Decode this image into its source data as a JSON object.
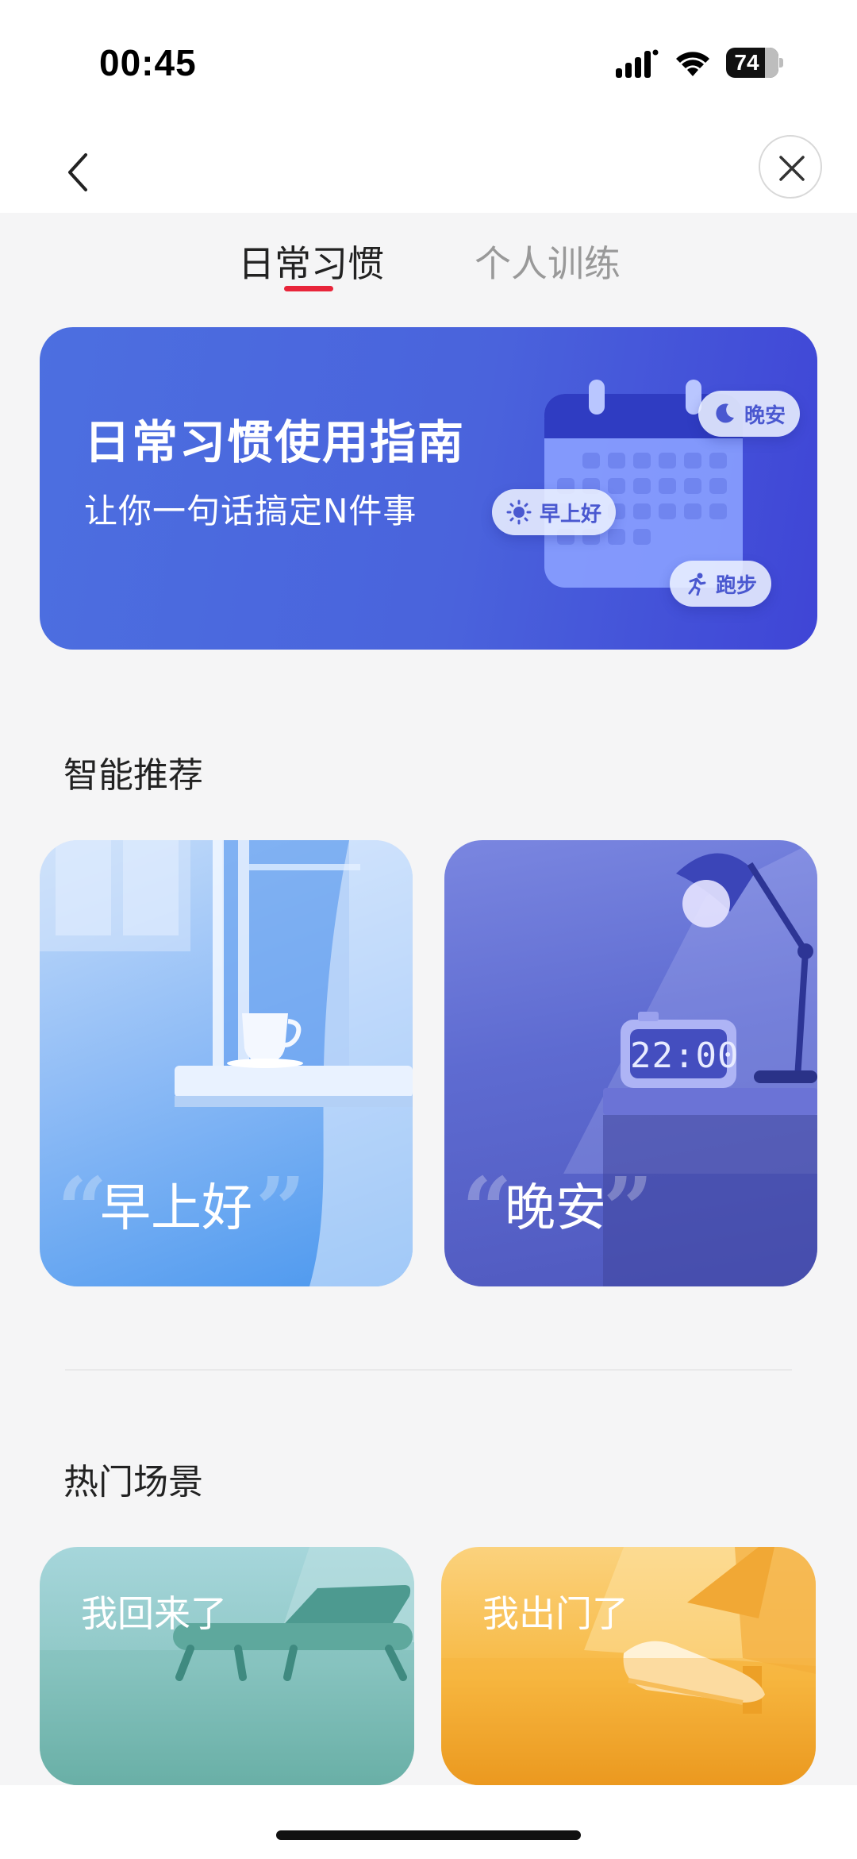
{
  "status_bar": {
    "time": "00:45",
    "battery": "74"
  },
  "tabs": [
    {
      "label": "日常习惯",
      "active": true
    },
    {
      "label": "个人训练",
      "active": false
    }
  ],
  "banner": {
    "title": "日常习惯使用指南",
    "subtitle": "让你一句话搞定N件事",
    "chips": {
      "night": "晚安",
      "morning": "早上好",
      "run": "跑步"
    }
  },
  "recommend": {
    "title": "智能推荐",
    "cards": [
      {
        "label": "早上好"
      },
      {
        "label": "晚安",
        "clock": "22:00"
      }
    ]
  },
  "scenes": {
    "title": "热门场景",
    "cards": [
      {
        "label": "我回来了"
      },
      {
        "label": "我出门了"
      }
    ]
  },
  "colors": {
    "accent": "#e8253a",
    "banner": "#4a63dc"
  }
}
